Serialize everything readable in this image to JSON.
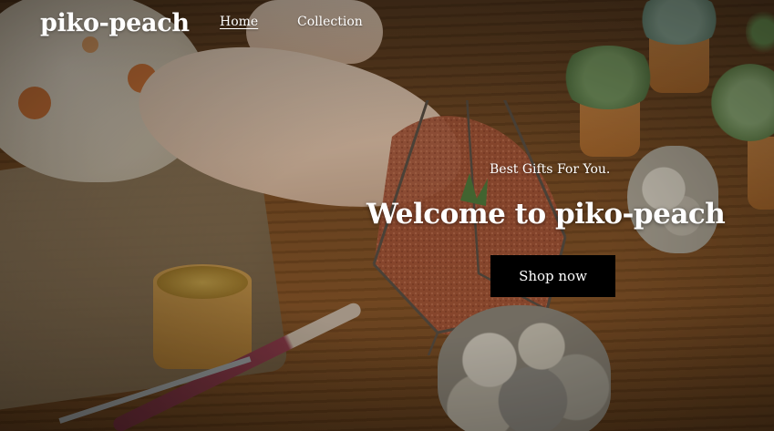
{
  "brand": {
    "name": "piko-peach"
  },
  "nav": {
    "items": [
      {
        "label": "Home",
        "active": true
      },
      {
        "label": "Collection",
        "active": false
      }
    ]
  },
  "hero": {
    "tagline": "Best Gifts For You.",
    "headline": "Welcome to piko-peach",
    "cta_label": "Shop now",
    "background_image": "hands assembling a glass geometric terrarium with succulents on a wooden table"
  },
  "colors": {
    "text": "#ffffff",
    "button_bg": "#000000",
    "button_text": "#ffffff"
  }
}
